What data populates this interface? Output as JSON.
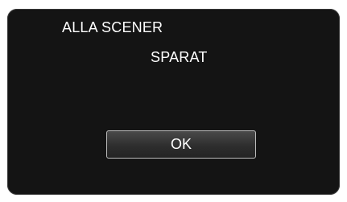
{
  "dialog": {
    "message_line_1": "ALLA SCENER",
    "message_line_2": "SPARAT",
    "ok_label": "OK"
  },
  "colors": {
    "screen_background": "#141414",
    "text": "#ffffff",
    "button_border": "#bdbdbd"
  }
}
